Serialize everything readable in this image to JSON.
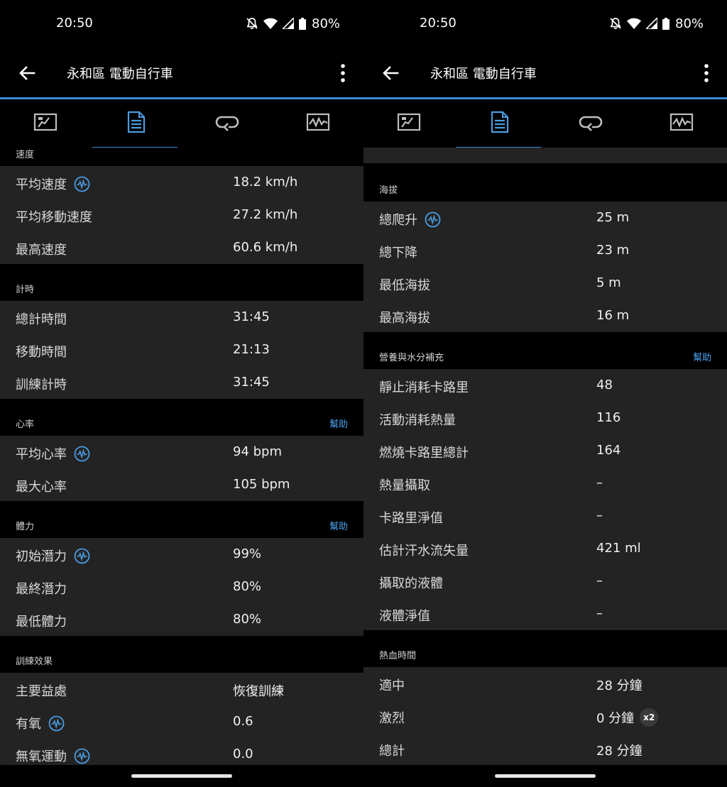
{
  "status": {
    "time": "20:50",
    "battery": "80%"
  },
  "header": {
    "title": "永和區 電動自行車",
    "back_icon": "arrow-left-icon",
    "more_icon": "more-vert-icon"
  },
  "colors": {
    "accent": "#3a8ad4",
    "help": "#4aa0ea",
    "row_bg": "#232323",
    "section_bg": "#000000"
  },
  "tabs": [
    {
      "icon": "overview-icon"
    },
    {
      "icon": "details-list-icon",
      "active": true
    },
    {
      "icon": "laps-icon"
    },
    {
      "icon": "charts-icon"
    }
  ],
  "left": {
    "sections": [
      {
        "heading": "速度",
        "rows": [
          {
            "label": "平均速度",
            "value": "18.2 km/h",
            "icon": true
          },
          {
            "label": "平均移動速度",
            "value": "27.2 km/h"
          },
          {
            "label": "最高速度",
            "value": "60.6 km/h"
          }
        ]
      },
      {
        "heading": "計時",
        "rows": [
          {
            "label": "總計時間",
            "value": "31:45"
          },
          {
            "label": "移動時間",
            "value": "21:13"
          },
          {
            "label": "訓練計時",
            "value": "31:45"
          }
        ]
      },
      {
        "heading": "心率",
        "help": "幫助",
        "rows": [
          {
            "label": "平均心率",
            "value": "94 bpm",
            "icon": true
          },
          {
            "label": "最大心率",
            "value": "105 bpm"
          }
        ]
      },
      {
        "heading": "體力",
        "help": "幫助",
        "rows": [
          {
            "label": "初始潛力",
            "value": "99%",
            "icon": true
          },
          {
            "label": "最終潛力",
            "value": "80%"
          },
          {
            "label": "最低體力",
            "value": "80%"
          }
        ]
      },
      {
        "heading": "訓練效果",
        "rows": [
          {
            "label": "主要益處",
            "value": "恢復訓練"
          },
          {
            "label": "有氧",
            "value": "0.6",
            "icon": true
          },
          {
            "label": "無氧運動",
            "value": "0.0",
            "icon": true
          }
        ]
      }
    ]
  },
  "right": {
    "sections": [
      {
        "heading": "海拔",
        "rows": [
          {
            "label": "總爬升",
            "value": "25 m",
            "icon": true
          },
          {
            "label": "總下降",
            "value": "23 m"
          },
          {
            "label": "最低海拔",
            "value": "5 m"
          },
          {
            "label": "最高海拔",
            "value": "16 m"
          }
        ]
      },
      {
        "heading": "營養與水分補充",
        "help": "幫助",
        "rows": [
          {
            "label": "靜止消耗卡路里",
            "value": "48"
          },
          {
            "label": "活動消耗熱量",
            "value": "116"
          },
          {
            "label": "燃燒卡路里總計",
            "value": "164"
          },
          {
            "label": "熱量攝取",
            "value": "–"
          },
          {
            "label": "卡路里淨值",
            "value": "–"
          },
          {
            "label": "估計汗水流失量",
            "value": "421 ml"
          },
          {
            "label": "攝取的液體",
            "value": "–"
          },
          {
            "label": "液體淨值",
            "value": "–"
          }
        ]
      },
      {
        "heading": "熱血時間",
        "rows": [
          {
            "label": "適中",
            "value": "28 分鐘"
          },
          {
            "label": "激烈",
            "value": "0 分鐘",
            "badge": "x2"
          },
          {
            "label": "總計",
            "value": "28 分鐘"
          }
        ]
      }
    ]
  }
}
